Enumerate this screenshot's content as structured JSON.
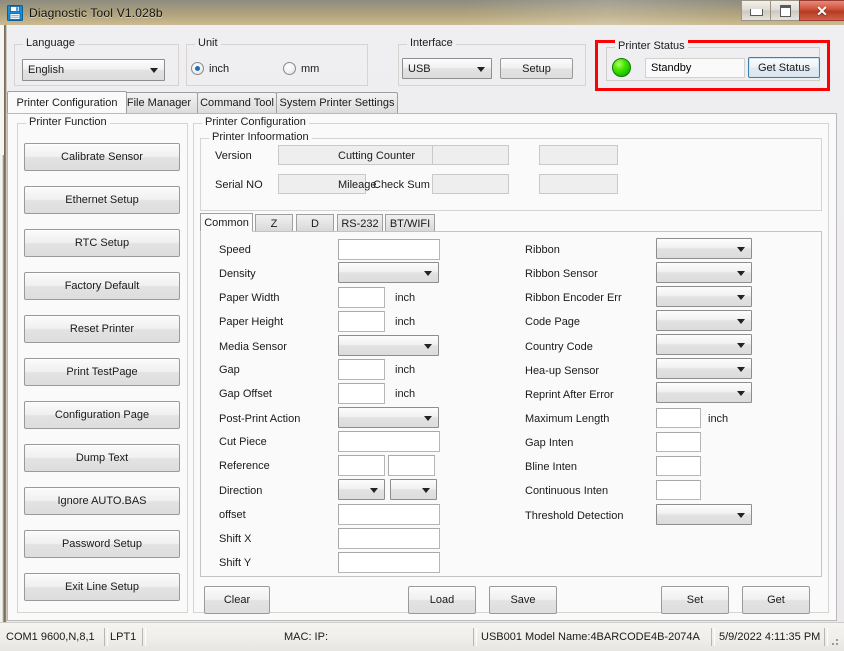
{
  "window": {
    "title": "Diagnostic Tool V1.028b",
    "icon": "floppy-disk-icon",
    "minimize_label": "",
    "maximize_label": "",
    "close_label": "✕"
  },
  "header": {
    "language": {
      "legend": "Language",
      "value": "English"
    },
    "unit": {
      "legend": "Unit",
      "options": [
        {
          "label": "inch",
          "selected": true
        },
        {
          "label": "mm",
          "selected": false
        }
      ]
    },
    "interface": {
      "legend": "Interface",
      "value": "USB",
      "setup_label": "Setup"
    },
    "printer_status": {
      "legend": "Printer  Status",
      "led_color": "#2ee000",
      "status_text": "Standby",
      "get_status_label": "Get Status",
      "highlight_color": "#fb0104"
    }
  },
  "tabs": [
    {
      "label": "Printer Configuration",
      "active": true
    },
    {
      "label": "File Manager",
      "active": false
    },
    {
      "label": "Command Tool",
      "active": false
    },
    {
      "label": "System Printer Settings",
      "active": false
    }
  ],
  "printer_function": {
    "legend": "Printer  Function",
    "buttons": [
      "Calibrate Sensor",
      "Ethernet Setup",
      "RTC Setup",
      "Factory Default",
      "Reset Printer",
      "Print TestPage",
      "Configuration Page",
      "Dump Text",
      "Ignore AUTO.BAS",
      "Password Setup",
      "Exit Line Setup"
    ]
  },
  "printer_configuration": {
    "legend": "Printer Configuration",
    "information": {
      "legend": "Printer Infoormation",
      "fields": [
        {
          "label": "Version",
          "value": ""
        },
        {
          "label": "Serial NO",
          "value": ""
        },
        {
          "label": "Check Sum",
          "value": ""
        },
        {
          "label": "Cutting Counter",
          "value": ""
        },
        {
          "label": "Mileage",
          "value": ""
        }
      ]
    },
    "subtabs": [
      {
        "label": "Common",
        "active": true
      },
      {
        "label": "Z",
        "active": false
      },
      {
        "label": "D",
        "active": false
      },
      {
        "label": "RS-232",
        "active": false
      },
      {
        "label": "BT/WIFI",
        "active": false
      }
    ],
    "common_left": [
      {
        "label": "Speed",
        "type": "text",
        "value": "",
        "unit": ""
      },
      {
        "label": "Density",
        "type": "combo",
        "value": "",
        "unit": ""
      },
      {
        "label": "Paper Width",
        "type": "text",
        "value": "",
        "unit": "inch"
      },
      {
        "label": "Paper Height",
        "type": "text",
        "value": "",
        "unit": "inch"
      },
      {
        "label": "Media Sensor",
        "type": "combo",
        "value": "",
        "unit": ""
      },
      {
        "label": "Gap",
        "type": "text",
        "value": "",
        "unit": "inch"
      },
      {
        "label": "Gap Offset",
        "type": "text",
        "value": "",
        "unit": "inch"
      },
      {
        "label": "Post-Print  Action",
        "type": "combo",
        "value": "",
        "unit": ""
      },
      {
        "label": "Cut  Piece",
        "type": "text",
        "value": "",
        "unit": ""
      },
      {
        "label": "Reference",
        "type": "text2",
        "value": "",
        "unit": ""
      },
      {
        "label": "Direction",
        "type": "combo2",
        "value": "",
        "unit": ""
      },
      {
        "label": "offset",
        "type": "text",
        "value": "",
        "unit": ""
      },
      {
        "label": "Shift X",
        "type": "text",
        "value": "",
        "unit": ""
      },
      {
        "label": "Shift Y",
        "type": "text",
        "value": "",
        "unit": ""
      }
    ],
    "common_right": [
      {
        "label": "Ribbon",
        "type": "combo",
        "value": "",
        "unit": ""
      },
      {
        "label": "Ribbon  Sensor",
        "type": "combo",
        "value": "",
        "unit": ""
      },
      {
        "label": "Ribbon Encoder Err",
        "type": "combo",
        "value": "",
        "unit": ""
      },
      {
        "label": "Code Page",
        "type": "combo",
        "value": "",
        "unit": ""
      },
      {
        "label": "Country Code",
        "type": "combo",
        "value": "",
        "unit": ""
      },
      {
        "label": "Hea-up  Sensor",
        "type": "combo",
        "value": "",
        "unit": ""
      },
      {
        "label": "Reprint After  Error",
        "type": "combo",
        "value": "",
        "unit": ""
      },
      {
        "label": "Maximum Length",
        "type": "text",
        "value": "",
        "unit": "inch"
      },
      {
        "label": "Gap Inten",
        "type": "text",
        "value": "",
        "unit": ""
      },
      {
        "label": "Bline  Inten",
        "type": "text",
        "value": "",
        "unit": ""
      },
      {
        "label": "Continuous  Inten",
        "type": "text",
        "value": "",
        "unit": ""
      },
      {
        "label": "Threshold  Detection",
        "type": "combo",
        "value": "",
        "unit": ""
      }
    ],
    "action_buttons": {
      "clear": "Clear",
      "load": "Load",
      "save": "Save",
      "set": "Set",
      "get": "Get"
    }
  },
  "statusbar": {
    "com": "COM1 9600,N,8,1",
    "lpt": "LPT1",
    "mac_ip": "MAC: IP:",
    "usb_model": "USB001  Model Name:4BARCODE4B-2074A",
    "datetime": "5/9/2022 4:11:35 PM"
  }
}
